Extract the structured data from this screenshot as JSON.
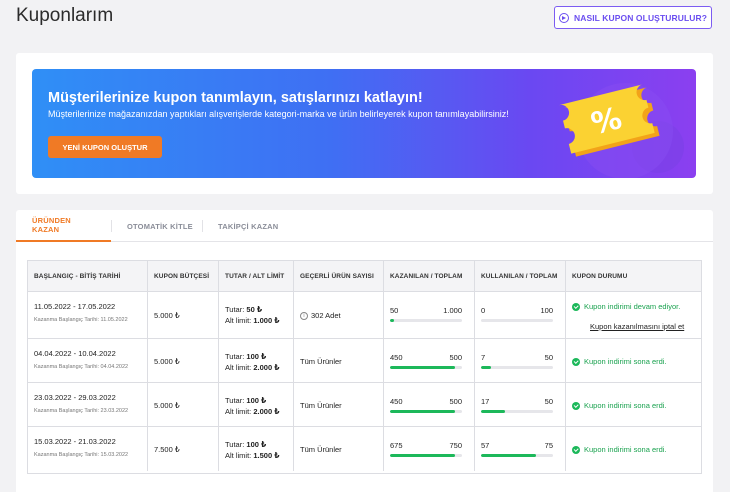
{
  "header": {
    "title": "Kuponlarım",
    "howto_button": "NASIL KUPON OLUŞTURULUR?"
  },
  "banner": {
    "title": "Müşterilerinize kupon tanımlayın, satışlarınızı katlayın!",
    "subtitle": "Müşterilerinize mağazanızdan yaptıkları alışverişlerde kategori-marka ve ürün belirleyerek kupon tanımlayabilirsiniz!",
    "button": "YENİ KUPON OLUŞTUR",
    "art_symbol": "%"
  },
  "tabs": [
    {
      "label": "ÜRÜNDEN KAZAN",
      "active": true
    },
    {
      "label": "OTOMATİK KİTLE",
      "active": false
    },
    {
      "label": "TAKİPÇİ KAZAN",
      "active": false
    }
  ],
  "table": {
    "headers": [
      "BAŞLANGIÇ - BİTİŞ TARİHİ",
      "KUPON BÜTÇESİ",
      "TUTAR / ALT LİMİT",
      "GEÇERLİ ÜRÜN SAYISI",
      "KAZANILAN / TOPLAM",
      "KULLANILAN / TOPLAM",
      "KUPON DURUMU"
    ],
    "rows": [
      {
        "date_range": "11.05.2022 - 17.05.2022",
        "start_note": "Kazanma Başlangıç Tarihi: 11.05.2022",
        "budget": "5.000 ₺",
        "amount_label": "Tutar:",
        "amount": "50 ₺",
        "limit_label": "Alt limit:",
        "limit": "1.000 ₺",
        "products": "302 Adet",
        "earned": "50",
        "earned_total": "1.000",
        "earned_ratio": 0.05,
        "used": "0",
        "used_total": "100",
        "used_ratio": 0.0,
        "status": "Kupon indirimi devam ediyor.",
        "action": "Kupon kazanılmasını iptal et"
      },
      {
        "date_range": "04.04.2022 - 10.04.2022",
        "start_note": "Kazanma Başlangıç Tarihi: 04.04.2022",
        "budget": "5.000 ₺",
        "amount_label": "Tutar:",
        "amount": "100 ₺",
        "limit_label": "Alt limit:",
        "limit": "2.000 ₺",
        "products": "Tüm Ürünler",
        "earned": "450",
        "earned_total": "500",
        "earned_ratio": 0.9,
        "used": "7",
        "used_total": "50",
        "used_ratio": 0.14,
        "status": "Kupon indirimi sona erdi."
      },
      {
        "date_range": "23.03.2022 - 29.03.2022",
        "start_note": "Kazanma Başlangıç Tarihi: 23.03.2022",
        "budget": "5.000 ₺",
        "amount_label": "Tutar:",
        "amount": "100 ₺",
        "limit_label": "Alt limit:",
        "limit": "2.000 ₺",
        "products": "Tüm Ürünler",
        "earned": "450",
        "earned_total": "500",
        "earned_ratio": 0.9,
        "used": "17",
        "used_total": "50",
        "used_ratio": 0.34,
        "status": "Kupon indirimi sona erdi."
      },
      {
        "date_range": "15.03.2022 - 21.03.2022",
        "start_note": "Kazanma Başlangıç Tarihi: 15.03.2022",
        "budget": "7.500 ₺",
        "amount_label": "Tutar:",
        "amount": "100 ₺",
        "limit_label": "Alt limit:",
        "limit": "1.500 ₺",
        "products": "Tüm Ürünler",
        "earned": "675",
        "earned_total": "750",
        "earned_ratio": 0.9,
        "used": "57",
        "used_total": "75",
        "used_ratio": 0.76,
        "status": "Kupon indirimi sona erdi."
      }
    ]
  },
  "colors": {
    "accent": "#f07a25",
    "brand_purple": "#6b4ef0",
    "success": "#1cb85a"
  }
}
